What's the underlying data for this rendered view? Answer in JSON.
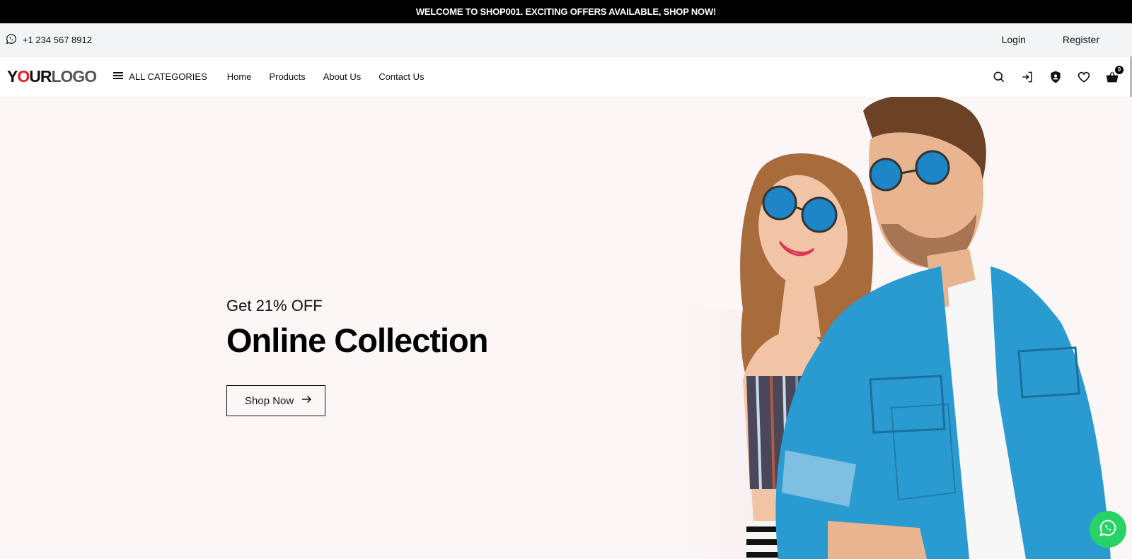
{
  "announcement": "WELCOME TO SHOP001. EXCITING OFFERS AVAILABLE, SHOP NOW!",
  "topbar": {
    "phone": "+1 234 567 8912",
    "login": "Login",
    "register": "Register"
  },
  "nav": {
    "logo_part1": "Y",
    "logo_red": "O",
    "logo_part2": "UR",
    "logo_part3": "LOGO",
    "all_categories": "ALL CATEGORIES",
    "menu": [
      "Home",
      "Products",
      "About Us",
      "Contact Us"
    ],
    "cart_count": "0",
    "icons": [
      "search-icon",
      "login-icon",
      "user-shield-icon",
      "heart-icon",
      "basket-icon"
    ]
  },
  "hero": {
    "subtitle": "Get 21% OFF",
    "title": "Online Collection",
    "button": "Shop Now"
  },
  "colors": {
    "announce_bg": "#000000",
    "topbar_bg": "#f3f4f6",
    "hero_bg": "#fdf6f6",
    "logo_accent": "#e11d2a",
    "whatsapp": "#25d366",
    "denim": "#2a9bd1"
  }
}
